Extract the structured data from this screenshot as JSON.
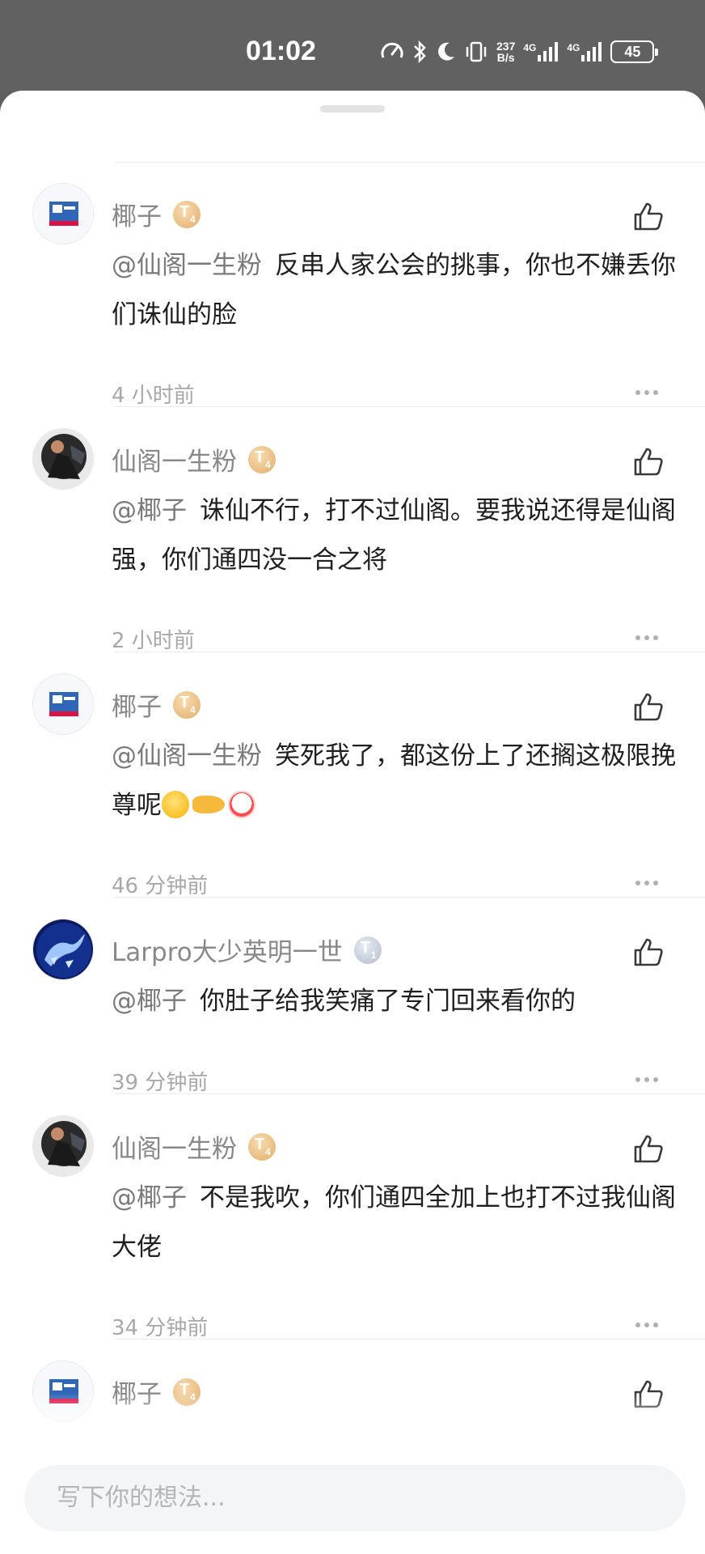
{
  "status_bar": {
    "time": "01:02",
    "net_speed_value": "237",
    "net_speed_unit": "B/s",
    "signal1": "4G",
    "signal2": "4G",
    "battery": "45"
  },
  "comments": [
    {
      "user": "椰子",
      "badge": "gold",
      "mention": "@仙阁一生粉",
      "text": "反串人家公会的挑事，你也不嫌丢你们诛仙的脸",
      "time": "4 小时前",
      "avatar": "blue-poster"
    },
    {
      "user": "仙阁一生粉",
      "badge": "gold",
      "mention": "@椰子",
      "text": "诛仙不行，打不过仙阁。要我说还得是仙阁强，你们通四没一合之将",
      "time": "2 小时前",
      "avatar": "dark-figure"
    },
    {
      "user": "椰子",
      "badge": "gold",
      "mention": "@仙阁一生粉",
      "text": "笑死我了，都这份上了还搁这极限挽尊呢",
      "emojis": [
        "rolling-laugh",
        "pointing-hand",
        "clown-face"
      ],
      "time": "46 分钟前",
      "avatar": "blue-poster"
    },
    {
      "user": "Larpro大少英明一世",
      "badge": "silver",
      "mention": "@椰子",
      "text": "你肚子给我笑痛了专门回来看你的",
      "time": "39 分钟前",
      "avatar": "blue-dragon"
    },
    {
      "user": "仙阁一生粉",
      "badge": "gold",
      "mention": "@椰子",
      "text": "不是我吹，你们通四全加上也打不过我仙阁大佬",
      "time": "34 分钟前",
      "avatar": "dark-figure"
    },
    {
      "user": "椰子",
      "badge": "gold",
      "avatar": "blue-poster"
    }
  ],
  "input": {
    "placeholder": "写下你的想法..."
  },
  "colors": {
    "status_bar_bg": "#616161",
    "username": "#888888",
    "body_text": "#1f1f1f",
    "time_text": "#a8a8a8",
    "badge_gold": "#e3ad6a",
    "badge_silver": "#b3bccb"
  },
  "icons": {
    "like": "thumbs-up-icon",
    "more": "more-dots-icon"
  }
}
